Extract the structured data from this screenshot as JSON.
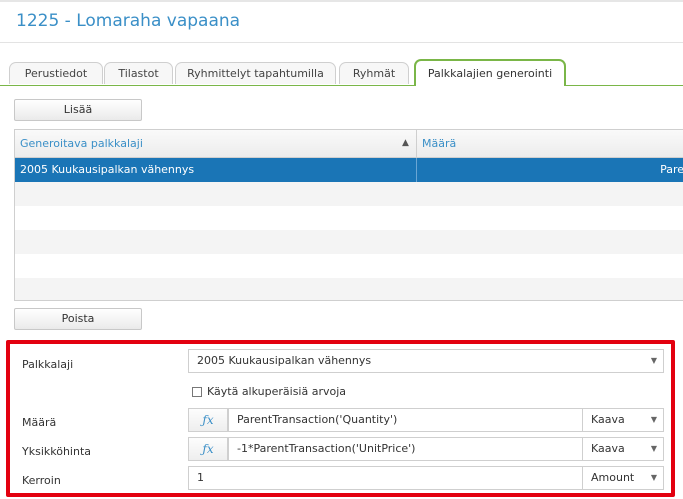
{
  "page": {
    "title": "1225 - Lomaraha vapaana"
  },
  "tabs": [
    {
      "label": "Perustiedot",
      "active": false
    },
    {
      "label": "Tilastot",
      "active": false
    },
    {
      "label": "Ryhmittelyt tapahtumilla",
      "active": false
    },
    {
      "label": "Ryhmät",
      "active": false
    },
    {
      "label": "Palkkalajien generointi",
      "active": true
    }
  ],
  "toolbar": {
    "add_label": "Lisää",
    "remove_label": "Poista"
  },
  "grid": {
    "columns": [
      "Generoitava palkkalaji",
      "Määrä"
    ],
    "sort_icon": "chevron-up-icon",
    "rows": [
      {
        "palkkalaji": "2005 Kuukausipalkan vähennys",
        "maara": "Pare",
        "selected": true
      }
    ]
  },
  "form": {
    "palkkalaji": {
      "label": "Palkkalaji",
      "value": "2005 Kuukausipalkan vähennys"
    },
    "checkbox": {
      "label": "Käytä alkuperäisiä arvoja",
      "checked": false
    },
    "maara": {
      "label": "Määrä",
      "value": "ParentTransaction('Quantity')",
      "mode": "Kaava"
    },
    "yksikkohinta": {
      "label": "Yksikköhinta",
      "value": "-1*ParentTransaction('UnitPrice')",
      "mode": "Kaava"
    },
    "kerroin": {
      "label": "Kerroin",
      "value": "1",
      "mode": "Amount"
    }
  },
  "colors": {
    "accent": "#3a8fc7",
    "tab_active": "#7ab648",
    "selection": "#1a75b6",
    "highlight_border": "#e3000f"
  }
}
